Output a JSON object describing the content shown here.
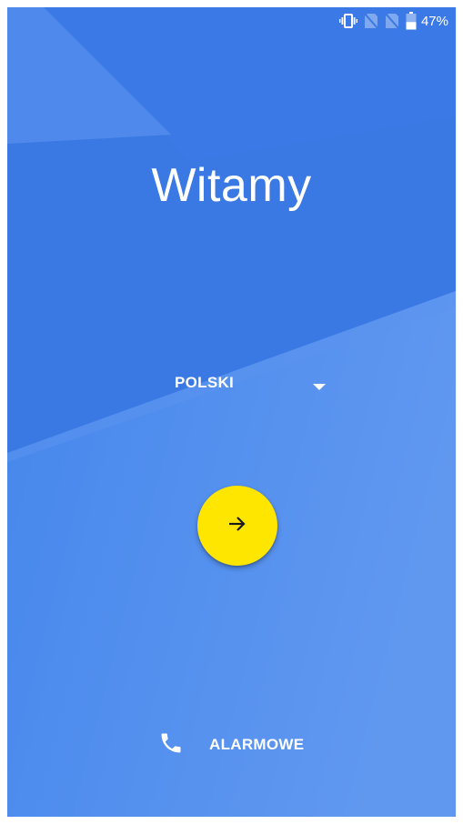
{
  "status_bar": {
    "icons": [
      "vibrate-icon",
      "no-sim-icon",
      "no-sim-icon",
      "battery-icon"
    ],
    "battery_percent": "47%",
    "battery_level": 0.47
  },
  "welcome": {
    "title": "Witamy"
  },
  "language": {
    "selected": "POLSKI",
    "icon": "dropdown-arrow-icon"
  },
  "next_button": {
    "icon": "arrow-right-icon",
    "color": "#ffe600"
  },
  "emergency": {
    "label": "ALARMOWE",
    "icon": "phone-icon"
  },
  "colors": {
    "background": "#3b7be5",
    "accent": "#ffe600",
    "text": "#ffffff"
  }
}
